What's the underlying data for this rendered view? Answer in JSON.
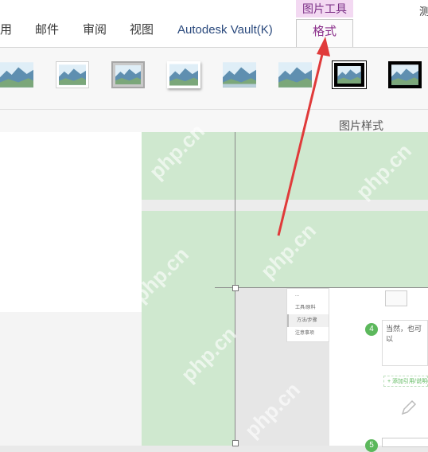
{
  "ribbon": {
    "context_header": "图片工具",
    "top_right_fragment": "测",
    "tabs": [
      {
        "label": "用"
      },
      {
        "label": "邮件"
      },
      {
        "label": "审阅"
      },
      {
        "label": "视图"
      },
      {
        "label": "Autodesk Vault(K)"
      }
    ],
    "active_tab": "格式",
    "group_label": "图片样式",
    "styles_count": 8
  },
  "content": {
    "menu_items": [
      "...",
      "工具/原料",
      "方法/步骤",
      "注意事项"
    ],
    "step4_number": "4",
    "step4_text": "当然，也可以",
    "add_text": "+ 添加引用/说明",
    "step5_number": "5",
    "watermark": "php.cn"
  },
  "colors": {
    "accent": "#8a2e8a",
    "context_bg": "#f3d9f2",
    "green": "#cfe8cf",
    "arrow": "#e03a3a",
    "step_badge": "#5cb85c"
  }
}
